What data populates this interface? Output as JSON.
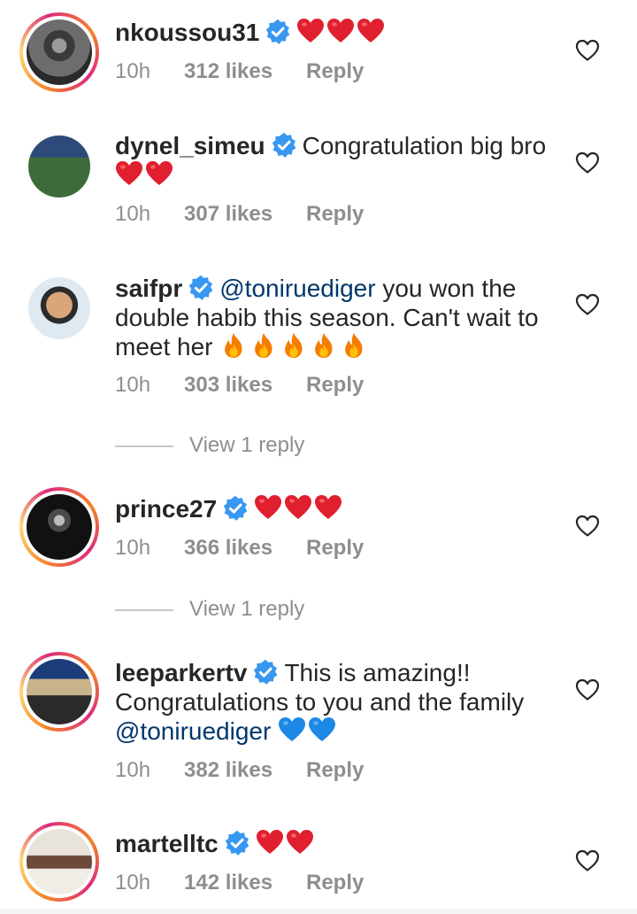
{
  "colors": {
    "verified": "#3897f0",
    "mention": "#00376b",
    "meta": "#8e8e8e",
    "heart_emoji": "#e0202f",
    "blue_heart_emoji": "#1e88e5",
    "fire_emoji": "#f57c00"
  },
  "icons": {
    "verified": "verified-badge-icon",
    "like": "heart-outline-icon",
    "red_heart": "red-heart-emoji",
    "blue_heart": "blue-heart-emoji",
    "fire": "fire-emoji"
  },
  "comments": [
    {
      "username": "nkoussou31",
      "verified": true,
      "text": "",
      "emojis": [
        "red-heart",
        "red-heart",
        "red-heart"
      ],
      "time": "10h",
      "likes": "312 likes",
      "reply_label": "Reply",
      "has_story": true
    },
    {
      "username": "dynel_simeu",
      "verified": true,
      "text": "Congratulation big bro",
      "emojis": [
        "red-heart",
        "red-heart"
      ],
      "time": "10h",
      "likes": "307 likes",
      "reply_label": "Reply",
      "has_story": false
    },
    {
      "username": "saifpr",
      "verified": true,
      "mention": "@toniruediger",
      "text": " you won the double habib this season. Can't wait to meet her",
      "emojis": [
        "fire",
        "fire",
        "fire",
        "fire",
        "fire"
      ],
      "time": "10h",
      "likes": "303 likes",
      "reply_label": "Reply",
      "view_replies": "View 1 reply",
      "has_story": false
    },
    {
      "username": "prince27",
      "verified": true,
      "text": "",
      "emojis": [
        "red-heart",
        "red-heart",
        "red-heart"
      ],
      "time": "10h",
      "likes": "366 likes",
      "reply_label": "Reply",
      "view_replies": "View 1 reply",
      "has_story": true
    },
    {
      "username": "leeparkertv",
      "verified": true,
      "text": "This is amazing!! Congratulations to you and the family",
      "mention": "@toniruediger",
      "emojis": [
        "blue-heart",
        "blue-heart"
      ],
      "time": "10h",
      "likes": "382 likes",
      "reply_label": "Reply",
      "has_story": true
    },
    {
      "username": "martelltc",
      "verified": true,
      "text": "",
      "emojis": [
        "red-heart",
        "red-heart"
      ],
      "time": "10h",
      "likes": "142 likes",
      "reply_label": "Reply",
      "has_story": true
    }
  ]
}
